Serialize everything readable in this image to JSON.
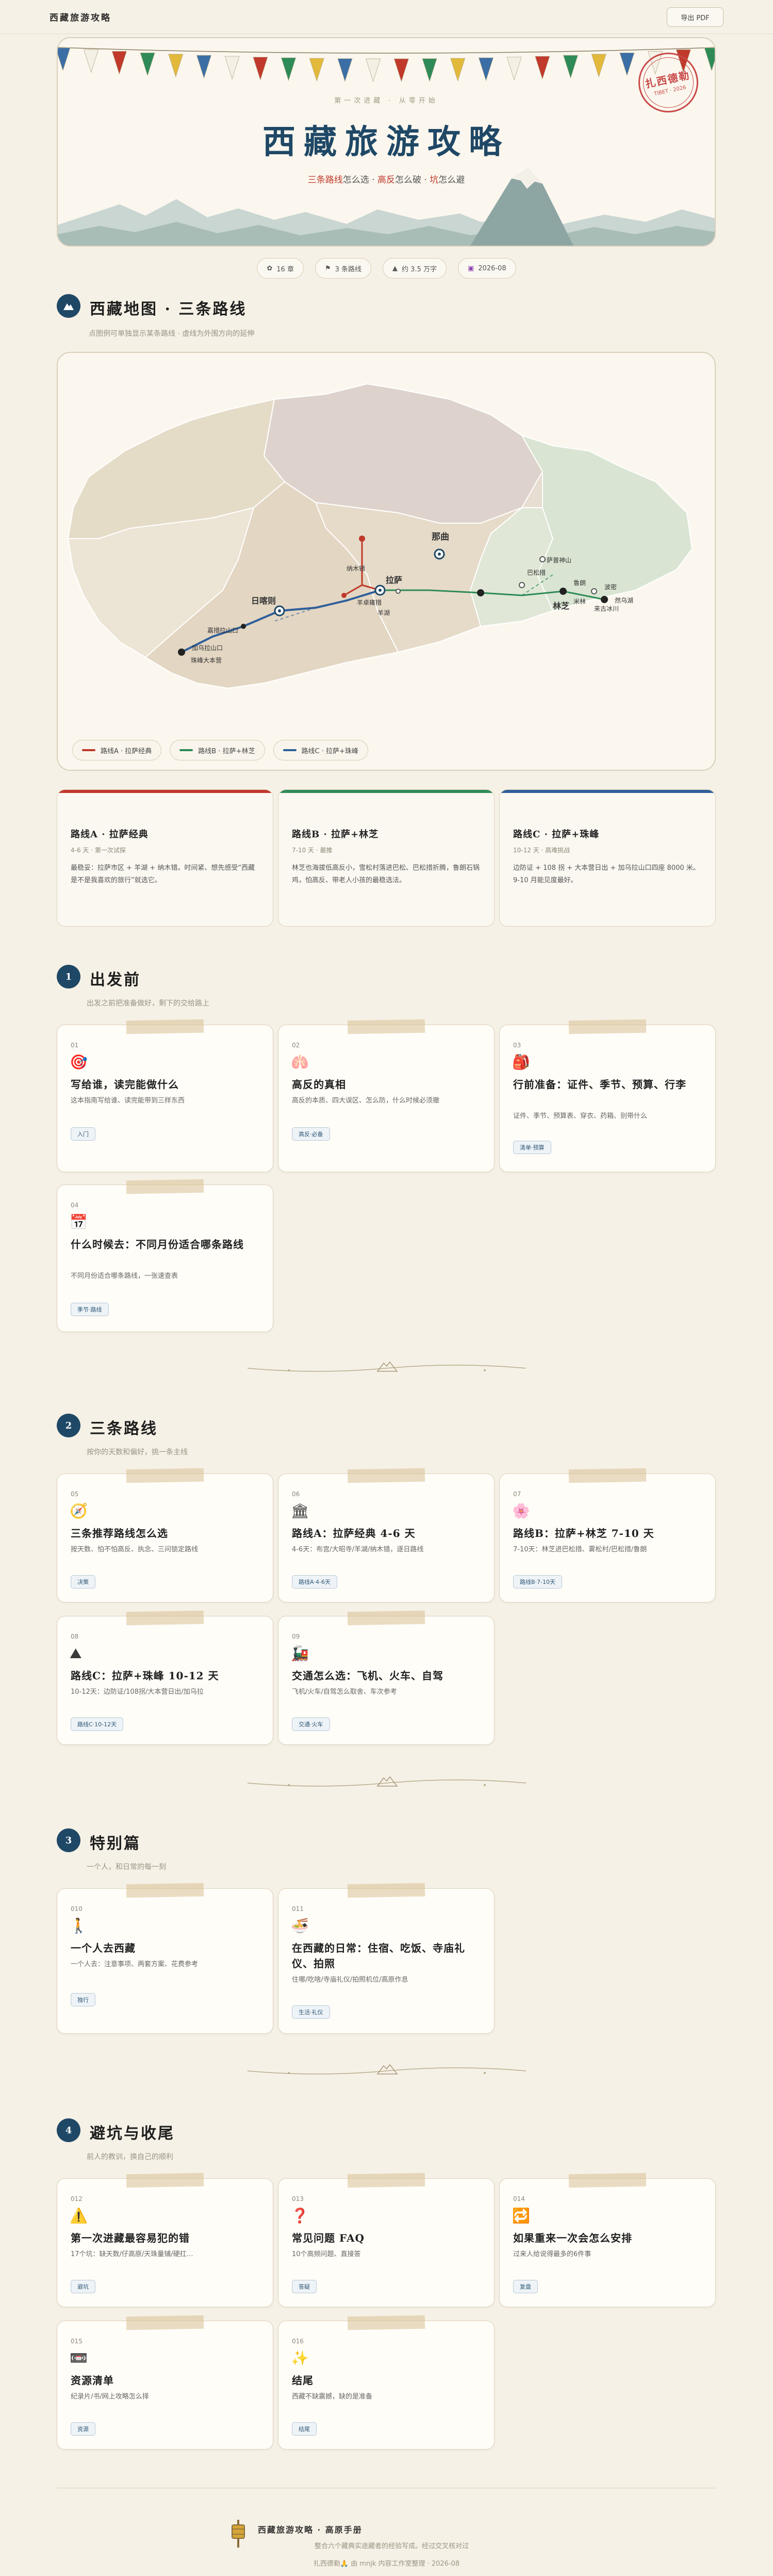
{
  "topbar": {
    "brand": "西藏旅游攻略",
    "pdf_button": "导出 PDF"
  },
  "hero": {
    "kicker": "第一次进藏 · 从零开始",
    "title": "西藏旅游攻略",
    "subtitle_parts": [
      "三条路线",
      "怎么选 · ",
      "高反",
      "怎么破 · ",
      "坑",
      "怎么避"
    ],
    "stamp_line1": "扎西德勒",
    "stamp_line2": "TIBET · 2026"
  },
  "chips": [
    {
      "icon": "book-icon",
      "glyph": "✿",
      "label": "16 章"
    },
    {
      "icon": "route-icon",
      "glyph": "⚑",
      "label": "3 条路线"
    },
    {
      "icon": "mountain-icon",
      "glyph": "▲",
      "label": "约 3.5 万字"
    },
    {
      "icon": "calendar-icon",
      "glyph": "▣",
      "label": "2026-08"
    }
  ],
  "map_section": {
    "title": "西藏地图 · 三条路线",
    "desc": "点图例可单独显示某条路线 · 虚线为外围方向的延伸"
  },
  "map": {
    "cities": [
      "那曲",
      "拉萨",
      "日喀则",
      "林芝",
      "米林",
      "巴松措",
      "鲁朗",
      "波密",
      "然乌湖",
      "来古冰川",
      "纳木错",
      "羊卓雍措",
      "羊湖",
      "嘉措拉山口",
      "加乌拉山口",
      "珠峰大本营",
      "萨普神山"
    ],
    "legend": [
      {
        "label": "路线A · 拉萨经典",
        "color": "#c0392b"
      },
      {
        "label": "路线B · 拉萨+林芝",
        "color": "#2e8b57"
      },
      {
        "label": "路线C · 拉萨+珠峰",
        "color": "#2f5f9a"
      }
    ]
  },
  "routes": [
    {
      "title": "路线A · 拉萨经典",
      "meta": "4-6 天 · 第一次试探",
      "desc": "最稳妥：拉萨市区 + 羊湖 + 纳木错。时间紧、想先感受“西藏是不是我喜欢的旅行”就选它。",
      "color": "#c0392b"
    },
    {
      "title": "路线B · 拉萨+林芝",
      "meta": "7-10 天 · 最推",
      "desc": "林芝也海拔低高反小，雪松村落进巴松、巴松措折腾，鲁朗石锅鸡，怕高反、带老人小孩的最稳选法。",
      "color": "#2e8b57"
    },
    {
      "title": "路线C · 拉萨+珠峰",
      "meta": "10-12 天 · 高难挑战",
      "desc": "边防证 + 108 拐 + 大本营日出 + 加乌拉山口四座 8000 米。9-10 月能见度最好。",
      "color": "#2f5f9a"
    }
  ],
  "sections": [
    {
      "badge": "1",
      "title": "出发前",
      "desc": "出发之前把准备做好，剩下的交给路上",
      "cards": [
        {
          "num": "01",
          "emoji": "🎯",
          "title": "写给谁，读完能做什么",
          "desc": "这本指南写给谁、读完能带到三样东西",
          "tag": "入门"
        },
        {
          "num": "02",
          "emoji": "🫁",
          "title": "高反的真相",
          "desc": "高反的本质、四大误区、怎么防，什么时候必须撤",
          "tag": "高反·必备"
        },
        {
          "num": "03",
          "emoji": "🎒",
          "title": "行前准备：证件、季节、预算、行李",
          "desc": "证件、季节、预算表、穿衣、药箱、别带什么",
          "tag": "清单·预算"
        },
        {
          "num": "04",
          "emoji": "📅",
          "title": "什么时候去：不同月份适合哪条路线",
          "desc": "不同月份适合哪条路线，一张速查表",
          "tag": "季节·路线"
        }
      ]
    },
    {
      "badge": "2",
      "title": "三条路线",
      "desc": "按你的天数和偏好，挑一条主线",
      "cards": [
        {
          "num": "05",
          "emoji": "🧭",
          "title": "三条推荐路线怎么选",
          "desc": "按天数、怕不怕高反、执念、三问锁定路线",
          "tag": "决策"
        },
        {
          "num": "06",
          "emoji": "🏛",
          "title": "路线A：拉萨经典 4-6 天",
          "desc": "4-6天：布宫/大昭寺/羊湖/纳木错，逐日路线",
          "tag": "路线A·4-6天"
        },
        {
          "num": "07",
          "emoji": "🌸",
          "title": "路线B：拉萨+林芝 7-10 天",
          "desc": "7-10天：林芝进巴松措、雾松村/巴松措/鲁朗",
          "tag": "路线B·7-10天"
        },
        {
          "num": "08",
          "emoji": "⛰",
          "title": "路线C：拉萨+珠峰 10-12 天",
          "desc": "10-12天：边防证/108拐/大本营日出/加乌拉",
          "tag": "路线C·10-12天"
        },
        {
          "num": "09",
          "emoji": "🚂",
          "title": "交通怎么选：飞机、火车、自驾",
          "desc": "飞机/火车/自驾怎么取舍、车次参考",
          "tag": "交通·火车"
        }
      ]
    },
    {
      "badge": "3",
      "title": "特别篇",
      "desc": "一个人，和日常的每一刻",
      "cards": [
        {
          "num": "010",
          "emoji": "🚶",
          "title": "一个人去西藏",
          "desc": "一个人去：注意事项、两套方案、花费参考",
          "tag": "独行"
        },
        {
          "num": "011",
          "emoji": "🍜",
          "title": "在西藏的日常：住宿、吃饭、寺庙礼仪、拍照",
          "desc": "住哪/吃啥/寺庙礼仪/拍照机位/高原作息",
          "tag": "生活·礼仪"
        }
      ]
    },
    {
      "badge": "4",
      "title": "避坑与收尾",
      "desc": "前人的教训，换自己的顺利",
      "cards": [
        {
          "num": "012",
          "emoji": "⚠️",
          "title": "第一次进藏最容易犯的错",
          "desc": "17个坑：缺天数/仔高原/天珠量铺/硬扛…",
          "tag": "避坑"
        },
        {
          "num": "013",
          "emoji": "❓",
          "title": "常见问题 FAQ",
          "desc": "10个高频问题、直接答",
          "tag": "答疑"
        },
        {
          "num": "014",
          "emoji": "🔁",
          "title": "如果重来一次会怎么安排",
          "desc": "过来人给说得最多的6件事",
          "tag": "复盘"
        },
        {
          "num": "015",
          "emoji": "📼",
          "title": "资源清单",
          "desc": "纪录片/书/网上攻略怎么择",
          "tag": "资源"
        },
        {
          "num": "016",
          "emoji": "✨",
          "title": "结尾",
          "desc": "西藏不缺震撼，缺的是准备",
          "tag": "结尾"
        }
      ]
    }
  ],
  "footer": {
    "title": "西藏旅游攻略 · 高原手册",
    "sub": "整合六个藏典实途藏者的经验写成。经过交叉核对过",
    "copy": "扎西德勒🙏 由 mnjk 内容工作室整理 · 2026-08"
  },
  "colors": {
    "primary": "#1f4866",
    "accent_red": "#c0392b",
    "route_b": "#2e8b57",
    "route_c": "#2f5f9a"
  }
}
